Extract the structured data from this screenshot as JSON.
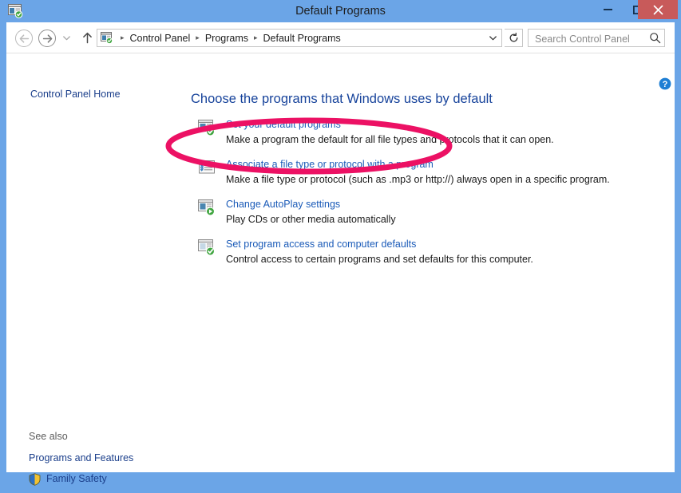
{
  "window": {
    "title": "Default Programs",
    "app_icon": "default-programs-icon",
    "controls": {
      "minimize": "–",
      "maximize": "☐",
      "close": "✕"
    }
  },
  "nav": {
    "back_label": "←",
    "forward_label": "→",
    "recent_label": "▾",
    "up_label": "↑",
    "refresh_label": "↻",
    "dropdown_label": "⌄",
    "breadcrumbs": [
      "Control Panel",
      "Programs",
      "Default Programs"
    ],
    "separator": "▸"
  },
  "search": {
    "placeholder": "Search Control Panel",
    "value": ""
  },
  "help": {
    "label": "?"
  },
  "sidebar": {
    "home_label": "Control Panel Home",
    "see_also_label": "See also",
    "see_also_items": [
      {
        "label": "Programs and Features",
        "icon": ""
      },
      {
        "label": "Family Safety",
        "icon": "shield-icon"
      }
    ]
  },
  "main": {
    "heading": "Choose the programs that Windows uses by default",
    "tasks": [
      {
        "icon": "set-default-programs-icon",
        "title": "Set your default programs",
        "desc": "Make a program the default for all file types and protocols that it can open."
      },
      {
        "icon": "associate-file-type-icon",
        "title": "Associate a file type or protocol with a program",
        "desc": "Make a file type or protocol (such as .mp3 or http://) always open in a specific program."
      },
      {
        "icon": "autoplay-icon",
        "title": "Change AutoPlay settings",
        "desc": "Play CDs or other media automatically"
      },
      {
        "icon": "program-access-icon",
        "title": "Set program access and computer defaults",
        "desc": "Control access to certain programs and set defaults for this computer."
      }
    ]
  },
  "annotation": {
    "shape": "ellipse",
    "color": "#ec1164",
    "target": "Associate a file type or protocol with a program"
  },
  "colors": {
    "window_frame": "#6ba5e7",
    "titlebar": "#6ba5e7",
    "close_button": "#c85a5a",
    "link": "#1b5bb8",
    "heading": "#17439b",
    "annotation": "#ec1164"
  }
}
